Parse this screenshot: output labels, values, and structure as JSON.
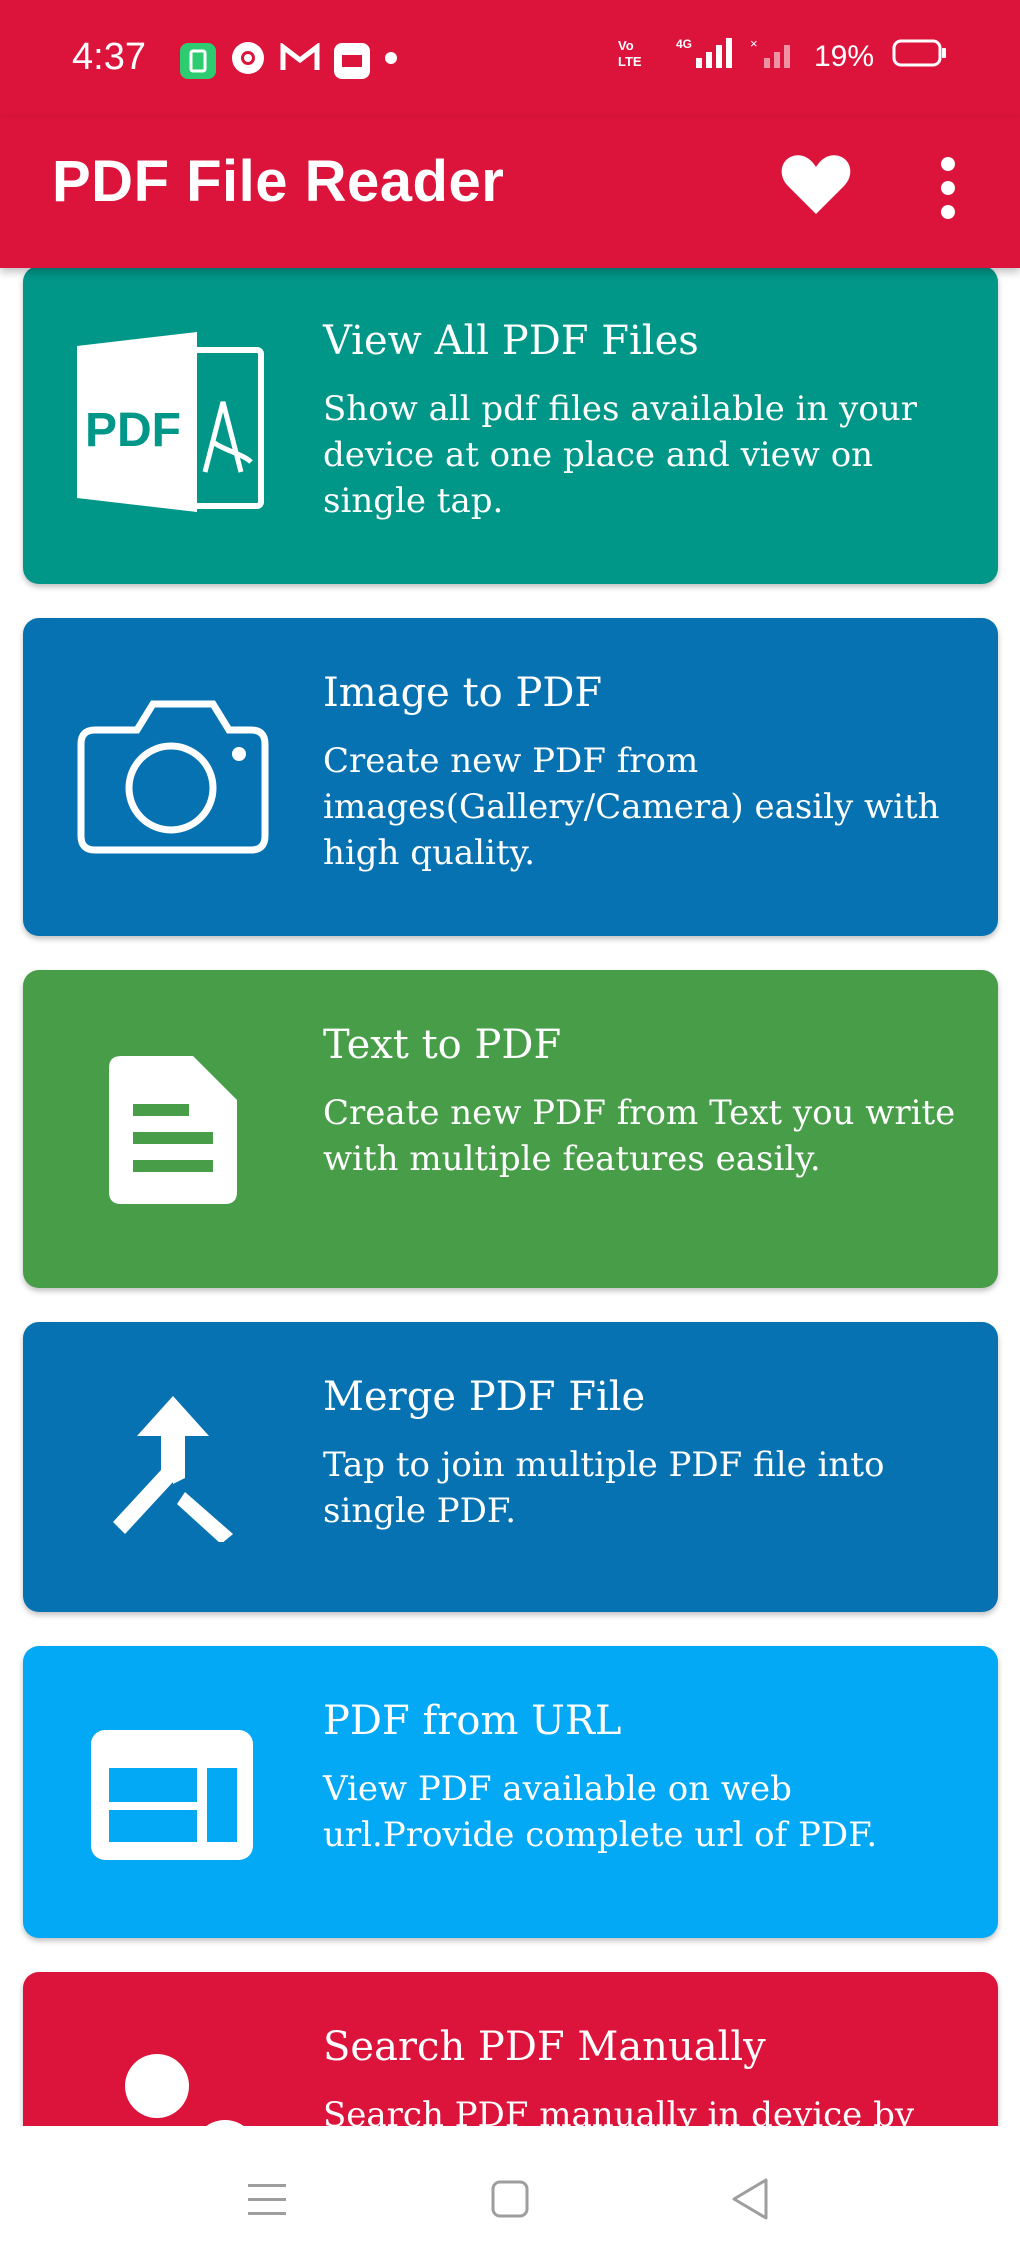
{
  "status_bar": {
    "time": "4:37",
    "battery": "19%",
    "notification_icons": [
      "battery-app-icon",
      "chrome-icon",
      "gmail-icon",
      "news-app-icon",
      "dot-icon"
    ],
    "system_icons": [
      "volte-icon",
      "4g-signal-icon",
      "no-signal-icon",
      "battery-icon"
    ]
  },
  "app_bar": {
    "title": "PDF File Reader",
    "actions": [
      "heart-icon",
      "overflow-menu-icon"
    ]
  },
  "cards": [
    {
      "title": "View All PDF Files",
      "description": "Show all pdf files available in your device at one place and view on single tap.",
      "color": "#009688",
      "icon": "pdf-file-icon"
    },
    {
      "title": "Image to PDF",
      "description": "Create new PDF from images(Gallery/Camera) easily with high quality.",
      "color": "#0672b1",
      "icon": "camera-icon"
    },
    {
      "title": "Text to PDF",
      "description": "Create new PDF from Text you write with multiple features easily.",
      "color": "#479d48",
      "icon": "text-document-icon"
    },
    {
      "title": "Merge PDF File",
      "description": "Tap to join multiple PDF file into single PDF.",
      "color": "#0672b1",
      "icon": "merge-icon"
    },
    {
      "title": "PDF from URL",
      "description": "View PDF available on web url.Provide complete url of PDF.",
      "color": "#03a9f4",
      "icon": "web-page-icon"
    },
    {
      "title": "Search PDF Manually",
      "description": "Search PDF manually in device by",
      "color": "#dc143c",
      "icon": "search-manual-icon"
    }
  ],
  "nav_bar": {
    "buttons": [
      "menu-nav-icon",
      "home-nav-icon",
      "back-nav-icon"
    ]
  }
}
